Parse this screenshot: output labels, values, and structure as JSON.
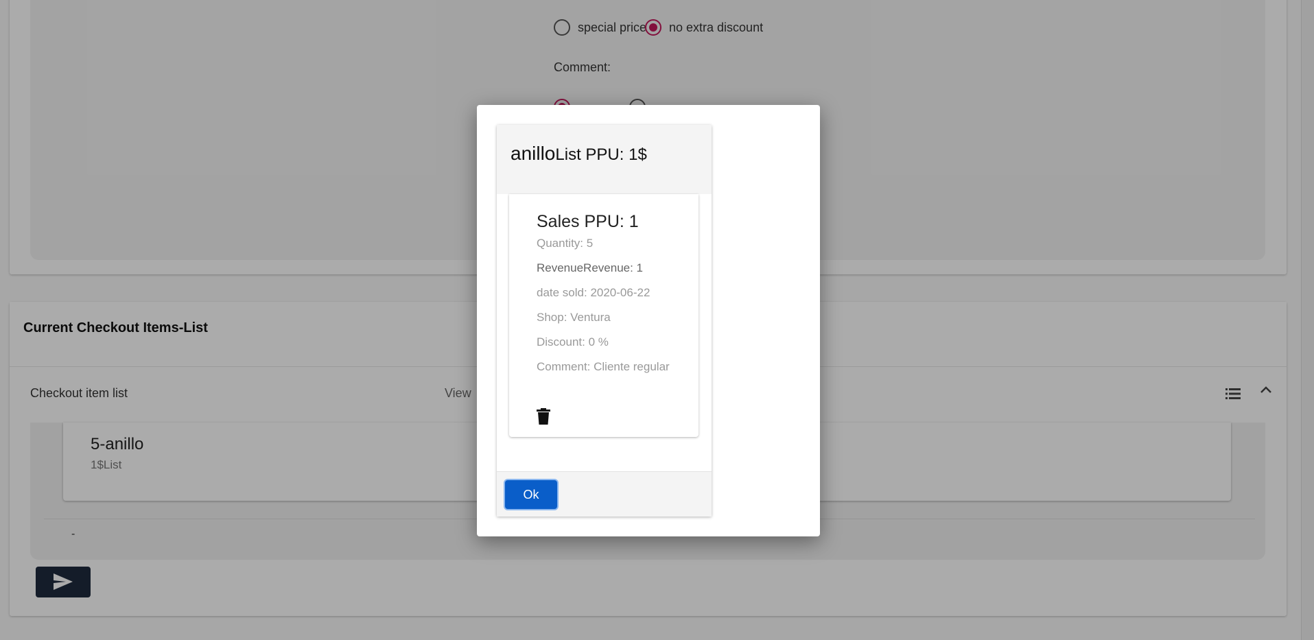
{
  "form": {
    "discount_options": [
      {
        "label": "special price",
        "selected": false
      },
      {
        "label": "no extra discount",
        "selected": true
      }
    ],
    "comment_label": "Comment:"
  },
  "checkout": {
    "title": "Current Checkout Items-List",
    "panel_label": "Checkout item list",
    "panel_view_text": "View",
    "list_icon": "list-icon",
    "expand_icon": "chevron-up-icon",
    "item": {
      "title": "5-anillo",
      "subtitle": "1$List"
    },
    "footer_dash": "-",
    "send_icon": "send-icon"
  },
  "modal": {
    "product_name": "anillo",
    "product_suffix": "List PPU: 1$",
    "sale": {
      "title": "Sales PPU: 1",
      "quantity": "Quantity: 5",
      "revenue": "RevenueRevenue: 1",
      "date_sold": "date sold: 2020-06-22",
      "shop": "Shop: Ventura",
      "discount": "Discount: 0 %",
      "comment": "Comment: Cliente regular"
    },
    "delete_icon": "trash-icon",
    "ok_label": "Ok"
  },
  "colors": {
    "accent_radio": "#c2185b",
    "primary_button": "#0a5ec9",
    "send_button": "#1f2b3e"
  }
}
